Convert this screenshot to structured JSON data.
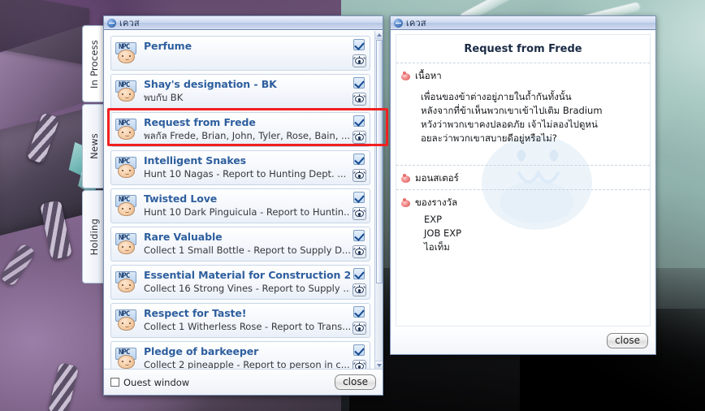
{
  "quest_list_window": {
    "title": "เควส",
    "title_icon": "minimize-circle-icon",
    "tabs": [
      {
        "label": "In Process",
        "active": true
      },
      {
        "label": "News",
        "active": false
      },
      {
        "label": "Holding",
        "active": false
      }
    ],
    "quests": [
      {
        "title": "Perfume",
        "desc": "",
        "checked": true,
        "selected": false
      },
      {
        "title": "Shay's designation - BK",
        "desc": "พบกับ BK",
        "checked": true,
        "selected": false
      },
      {
        "title": "Request from Frede",
        "desc": "พลกัล Frede, Brian, John, Tyler, Rose, Bain, ...",
        "checked": true,
        "selected": true
      },
      {
        "title": "Intelligent Snakes",
        "desc": "Hunt 10 Nagas - Report to Hunting Dept. ...",
        "checked": true,
        "selected": false
      },
      {
        "title": "Twisted Love",
        "desc": "Hunt 10 Dark Pinguicula - Report to Huntin...",
        "checked": true,
        "selected": false
      },
      {
        "title": "Rare Valuable",
        "desc": "Collect 1 Small Bottle - Report to Supply D...",
        "checked": true,
        "selected": false
      },
      {
        "title": "Essential Material for Construction 2",
        "desc": "Collect 16 Strong Vines - Report to Supply ...",
        "checked": true,
        "selected": false
      },
      {
        "title": "Respect for Taste!",
        "desc": "Collect 1 Witherless Rose - Report to Trans...",
        "checked": true,
        "selected": false
      },
      {
        "title": "Pledge of barkeeper",
        "desc": "Collect 2 pineapple - Report to person in c...",
        "checked": true,
        "selected": false
      }
    ],
    "footer": {
      "checkbox_label": "Ouest window",
      "checkbox_checked": false,
      "close_label": "close"
    },
    "row_icons": {
      "npc": "npc-head-icon",
      "check": "checkbox-checked-icon",
      "eye": "eye-icon"
    }
  },
  "quest_detail_window": {
    "title": "เควส",
    "title_icon": "minimize-circle-icon",
    "heading": "Request from Frede",
    "sections": [
      {
        "label": "เนื้อหา",
        "lines": [
          "เพื่อนของข้าต่างอยู่ภายในถ้ำกันทั้งนั้น",
          "หลังจากที่ข้าเห็นพวกเขาเข้าไปเติม Bradium",
          "หวังว่าพวกเขาคงปลอดภัย เจ้าไม่ลองไปดูหน่",
          "อยละว่าพวกเขาสบายดีอยู่หรือไม่?"
        ]
      },
      {
        "label": "มอนสเตอร์",
        "lines": []
      },
      {
        "label": "ของรางวัล",
        "lines": [
          "EXP",
          "JOB EXP",
          "ไอเท็ม"
        ]
      }
    ],
    "close_label": "close",
    "watermark": "poring-watermark"
  },
  "colors": {
    "accent_blue": "#2e5f9e",
    "selection_red": "#f02020",
    "title_bar": "#b5c6e4",
    "check_blue": "#14488f"
  }
}
